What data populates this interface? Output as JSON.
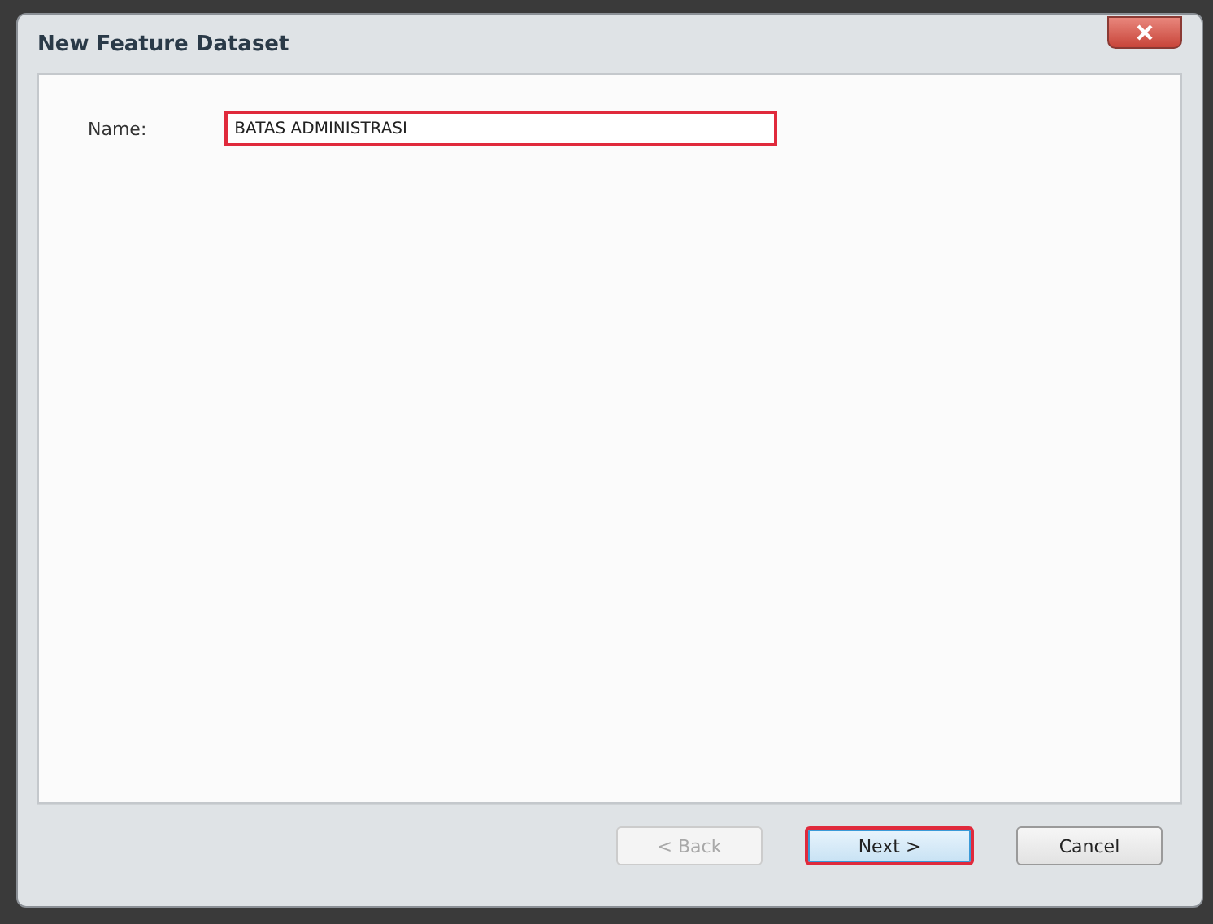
{
  "window": {
    "title": "New Feature Dataset"
  },
  "name_field": {
    "label": "Name:",
    "value": "BATAS ADMINISTRASI",
    "highlighted": true
  },
  "buttons": [
    {
      "label": "< Back",
      "disabled": true,
      "highlighted": false
    },
    {
      "label": "Next >",
      "disabled": false,
      "highlighted": true
    },
    {
      "label": "Cancel",
      "disabled": false,
      "highlighted": false
    }
  ]
}
